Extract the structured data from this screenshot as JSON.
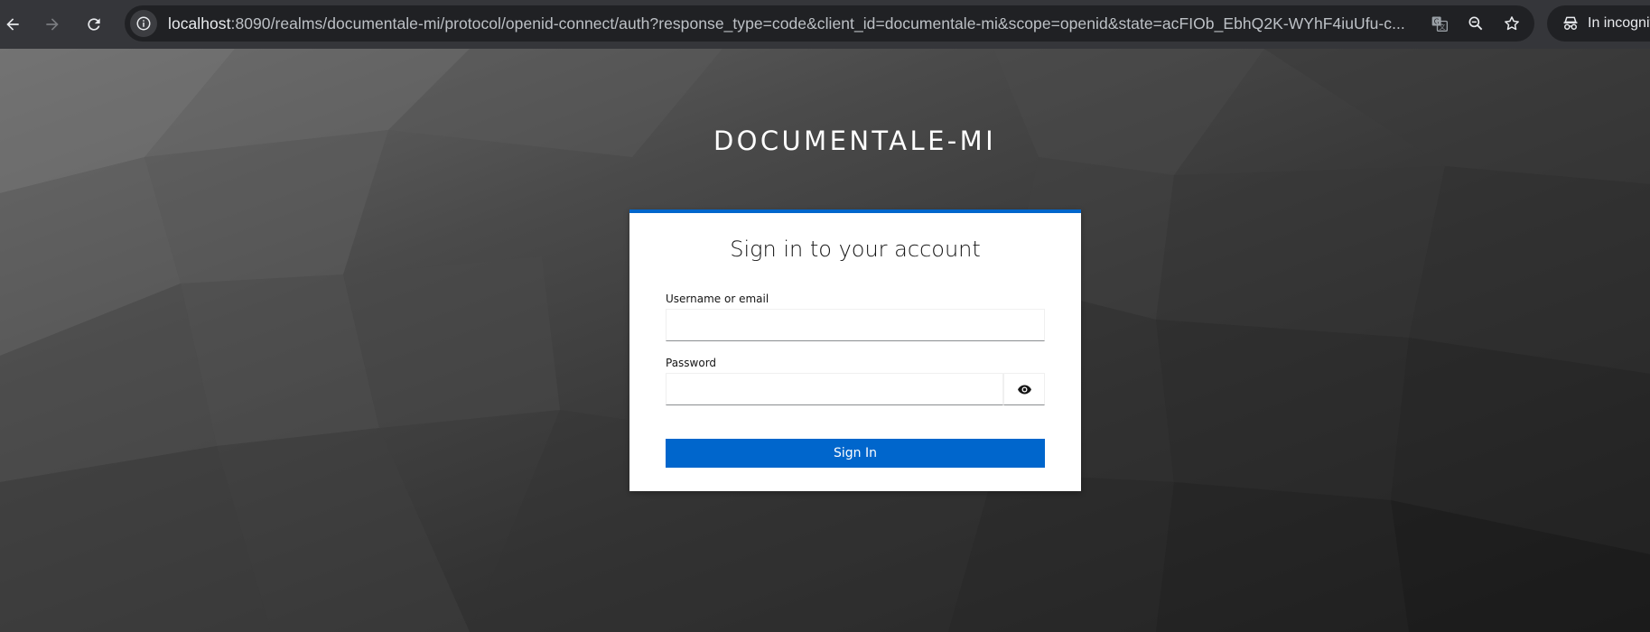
{
  "browser": {
    "url": {
      "host": "localhost",
      "rest": ":8090/realms/documentale-mi/protocol/openid-connect/auth?response_type=code&client_id=documentale-mi&scope=openid&state=acFIOb_EbhQ2K-WYhF4iuUfu-c..."
    },
    "incognito_label": "In incognito",
    "icons": {
      "back": "back-arrow-icon",
      "forward": "forward-arrow-icon",
      "reload": "reload-icon",
      "site_info": "info-icon",
      "translate": "translate-icon",
      "zoom": "zoom-icon",
      "bookmark": "star-icon",
      "incognito": "incognito-icon"
    }
  },
  "page": {
    "realm_title": "DOCUMENTALE-MI",
    "card": {
      "title": "Sign in to your account",
      "username_label": "Username or email",
      "username_value": "",
      "password_label": "Password",
      "password_value": "",
      "password_toggle_icon": "eye-icon",
      "submit_label": "Sign In"
    },
    "colors": {
      "accent": "#0066cc",
      "card_background": "#ffffff",
      "title_text": "#ffffff"
    }
  }
}
